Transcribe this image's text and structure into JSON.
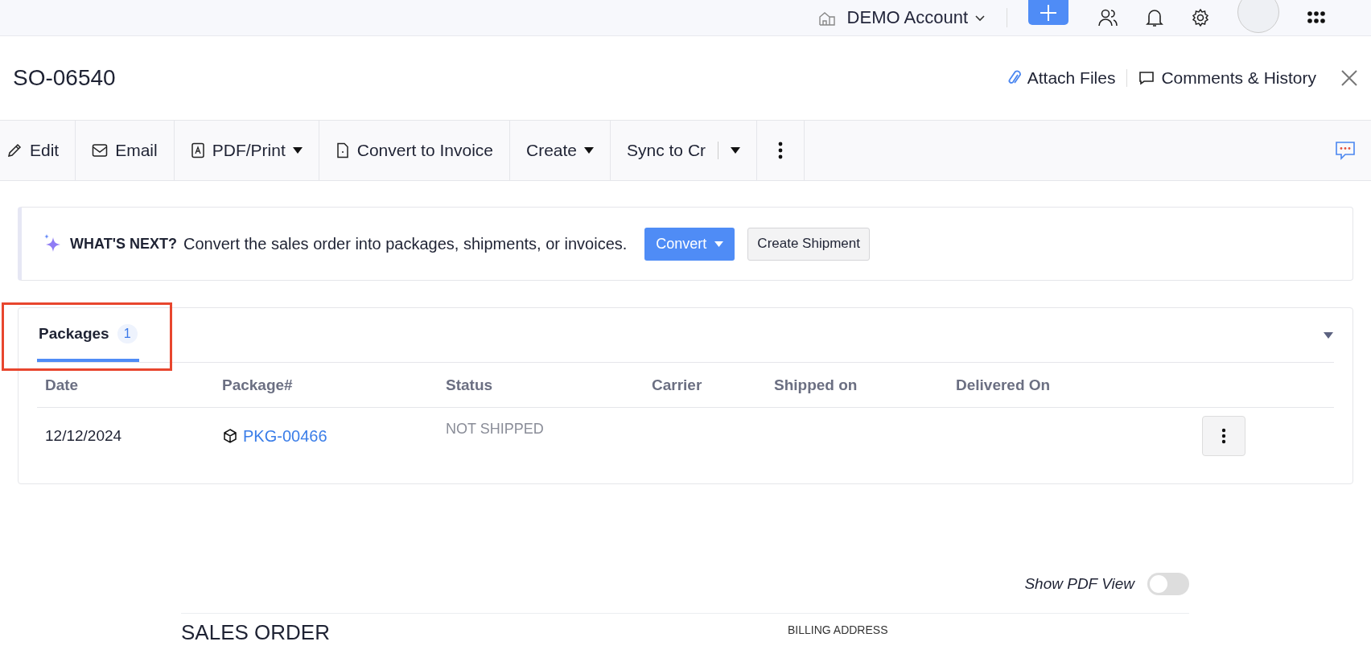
{
  "top_bar": {
    "account": "DEMO Account"
  },
  "header": {
    "title": "SO-06540",
    "attach": "Attach Files",
    "comments": "Comments & History"
  },
  "toolbar": [
    {
      "kind": "pencil",
      "label": "Edit",
      "dropdown": false
    },
    {
      "kind": "mail",
      "label": "Email",
      "dropdown": false
    },
    {
      "kind": "pdf",
      "label": "PDF/Print",
      "dropdown": true
    },
    {
      "kind": "doc",
      "label": "Convert to Invoice",
      "dropdown": false
    },
    {
      "kind": "none",
      "label": "Create",
      "dropdown": true
    },
    {
      "kind": "split",
      "label": "Sync to Cr",
      "dropdown": true
    }
  ],
  "banner": {
    "heading": "WHAT'S NEXT?",
    "text": "Convert the sales order into packages, shipments, or invoices.",
    "primary": "Convert",
    "secondary": "Create Shipment"
  },
  "packages": {
    "tabs": [
      {
        "label": "Packages",
        "count": "1",
        "selected": true
      }
    ],
    "highlighted": true,
    "table": {
      "columns": [
        "Date",
        "Package#",
        "Status",
        "Carrier",
        "Shipped on",
        "Delivered On"
      ],
      "rows": [
        {
          "date": "12/12/2024",
          "package": "PKG-00466",
          "status": "NOT SHIPPED",
          "carrier": "",
          "shipped_on": "",
          "delivered_on": ""
        }
      ]
    }
  },
  "pdf_view": {
    "label": "Show PDF View",
    "on": false
  },
  "document": {
    "title": "SALES ORDER",
    "billing": "BILLING ADDRESS"
  }
}
